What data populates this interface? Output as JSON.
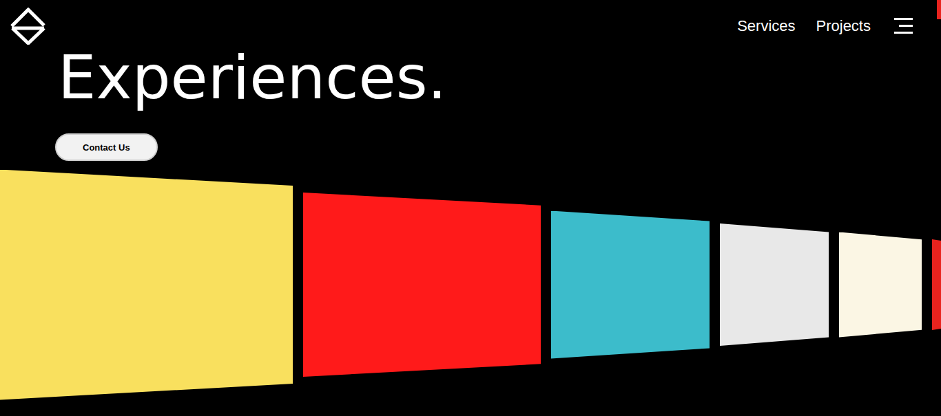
{
  "nav": {
    "links": [
      {
        "label": "Services"
      },
      {
        "label": "Projects"
      }
    ]
  },
  "hero": {
    "heading": "Experiences.",
    "cta": "Contact Us"
  },
  "carousel": {
    "cards": [
      {
        "color": "#f9e05e"
      },
      {
        "color": "#ff1a1a"
      },
      {
        "color": "#3cbccb"
      },
      {
        "color": "#e8e8e8"
      },
      {
        "color": "#fbf6e4"
      },
      {
        "color": "#e8231e"
      }
    ]
  }
}
